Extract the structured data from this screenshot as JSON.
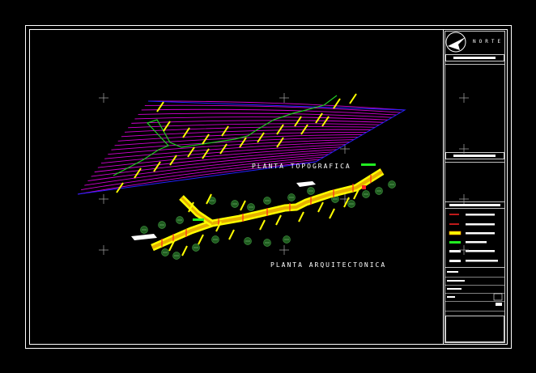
{
  "drawing": {
    "plan_titles": {
      "topographic": "PLANTA TOPOGRAFICA",
      "architectural": "PLANTA ARQUITECTONICA"
    },
    "north_label": "NORTE"
  },
  "colors": {
    "background": "#000000",
    "frame": "#ffffff",
    "contour_lines": "#d400d4",
    "contour_edge": "#2222ff",
    "path_centerline": "#22cc22",
    "road_fill": "#ffff00",
    "road_axis": "#ff2222",
    "trees": "#2e7d32",
    "labels": "#ffff00"
  },
  "legend_symbols": [
    "red-line",
    "red-line",
    "yellow-hatch",
    "green-bar",
    "white-bar",
    "white-bar"
  ]
}
